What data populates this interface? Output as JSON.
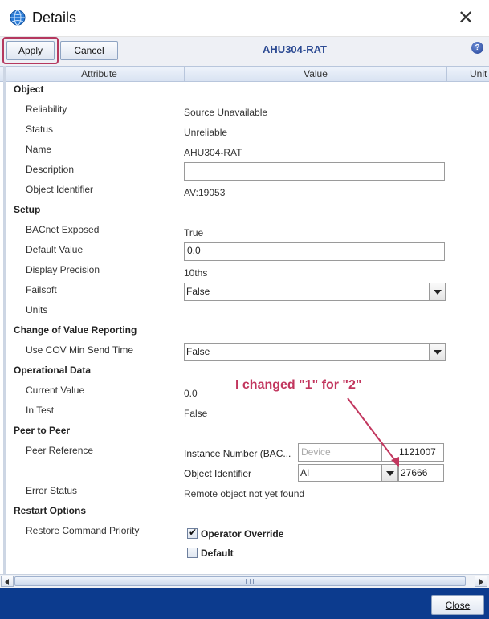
{
  "window": {
    "title": "Details",
    "close_glyph": "✕",
    "app_icon": "globe-icon"
  },
  "toolbar": {
    "apply_label": "Apply",
    "cancel_label": "Cancel",
    "object_name": "AHU304-RAT",
    "help_glyph": "?"
  },
  "columns": {
    "attribute": "Attribute",
    "value": "Value",
    "unit": "Unit"
  },
  "sections": {
    "object": "Object",
    "setup": "Setup",
    "cov": "Change of Value Reporting",
    "operational": "Operational Data",
    "peer": "Peer to Peer",
    "restart": "Restart Options"
  },
  "object": {
    "reliability_label": "Reliability",
    "reliability_value": "Source Unavailable",
    "status_label": "Status",
    "status_value": "Unreliable",
    "name_label": "Name",
    "name_value": "AHU304-RAT",
    "description_label": "Description",
    "description_value": "",
    "identifier_label": "Object Identifier",
    "identifier_value": "AV:19053"
  },
  "setup": {
    "bacnet_label": "BACnet Exposed",
    "bacnet_value": "True",
    "default_label": "Default Value",
    "default_value": "0.0",
    "precision_label": "Display Precision",
    "precision_value": "10ths",
    "failsoft_label": "Failsoft",
    "failsoft_value": "False",
    "units_label": "Units"
  },
  "cov": {
    "min_send_label": "Use COV Min Send Time",
    "min_send_value": "False"
  },
  "operational": {
    "current_label": "Current Value",
    "current_value": "0.0",
    "intest_label": "In Test",
    "intest_value": "False"
  },
  "peer": {
    "reference_label": "Peer Reference",
    "instance_label": "Instance Number (BAC...",
    "device_placeholder": "Device",
    "instance_value": "1121007",
    "object_id_label": "Object Identifier",
    "object_type_value": "AI",
    "object_number_value": "27666",
    "error_label": "Error Status",
    "error_value": "Remote object not yet found"
  },
  "restart": {
    "restore_label": "Restore Command Priority",
    "operator_override_label": "Operator Override",
    "operator_override_checked": true,
    "default_label": "Default",
    "default_checked": false
  },
  "annotation": {
    "text": "I changed \"1\" for \"2\"",
    "color": "#c2365e"
  },
  "footer": {
    "close_label": "Close"
  },
  "colors": {
    "footer_bg": "#0c3b8e",
    "object_name": "#2d4b93",
    "apply_highlight": "#b5385f"
  }
}
